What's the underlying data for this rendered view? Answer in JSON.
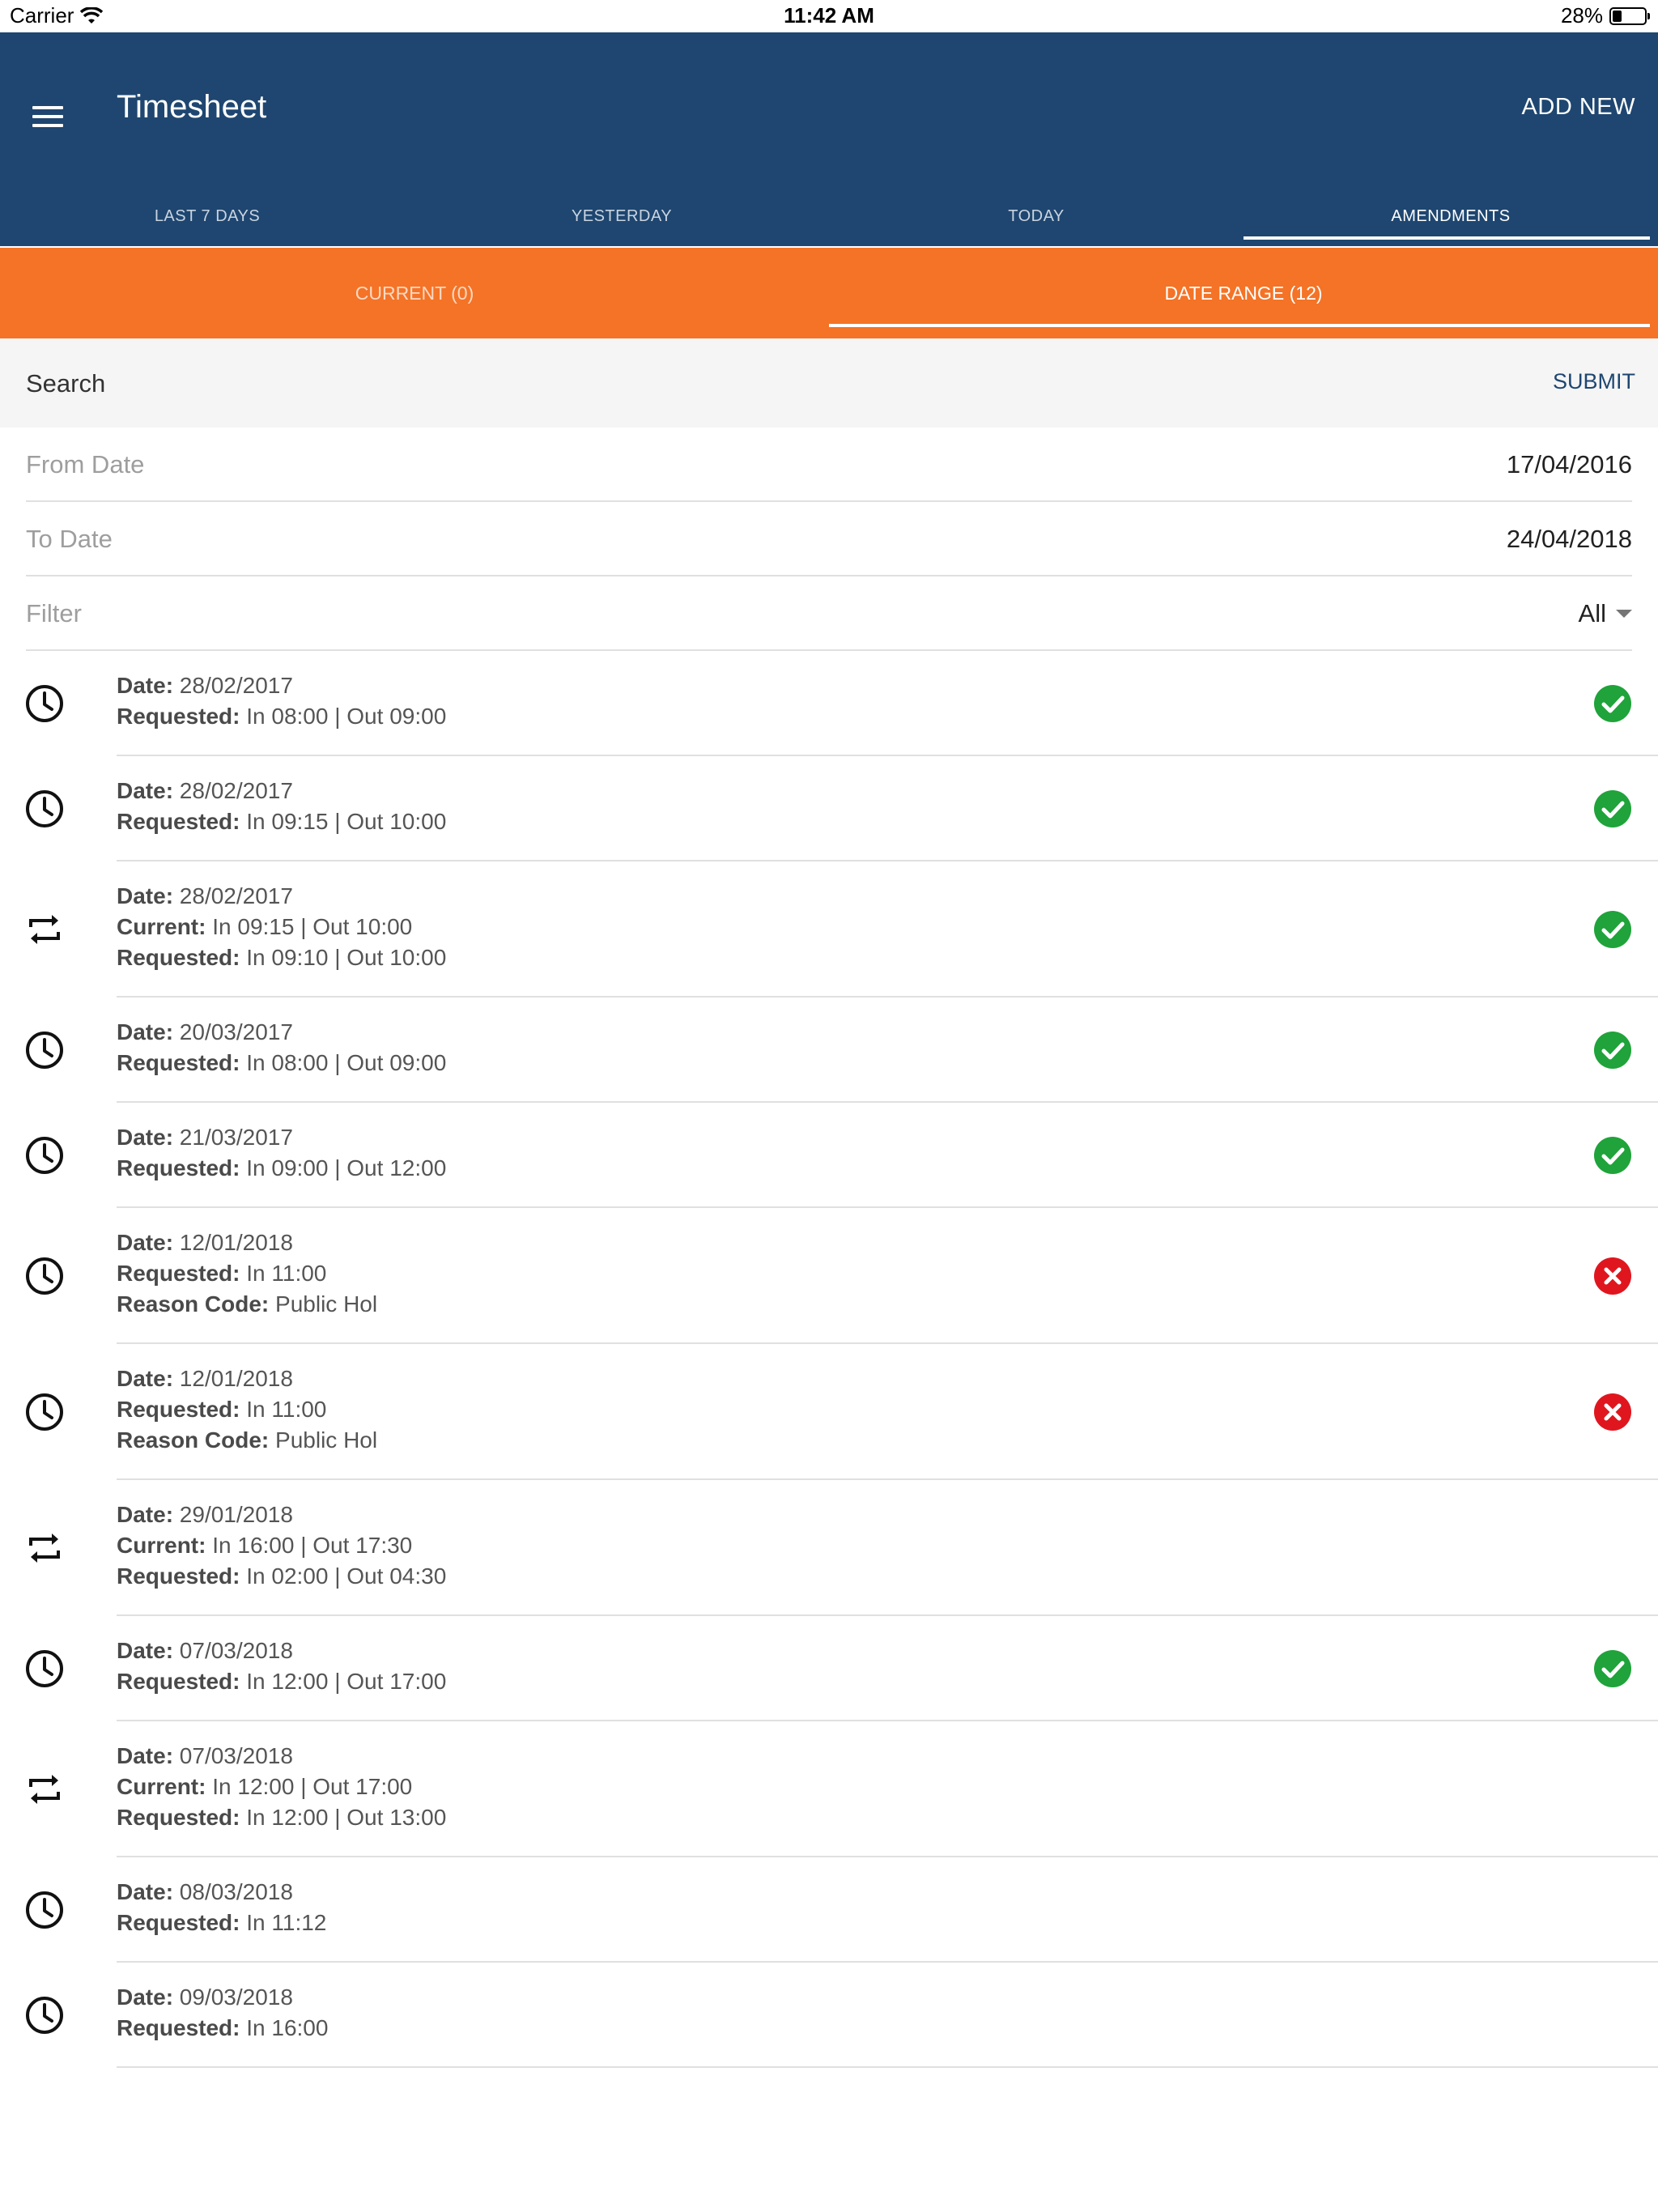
{
  "status_bar": {
    "carrier": "Carrier",
    "time": "11:42 AM",
    "battery": "28%",
    "battery_level": 0.28
  },
  "header": {
    "title": "Timesheet",
    "add_new": "ADD NEW"
  },
  "main_tabs": [
    {
      "label": "LAST 7 DAYS",
      "active": false
    },
    {
      "label": "YESTERDAY",
      "active": false
    },
    {
      "label": "TODAY",
      "active": false
    },
    {
      "label": "AMENDMENTS",
      "active": true
    }
  ],
  "sub_tabs": [
    {
      "label": "CURRENT (0)",
      "active": false
    },
    {
      "label": "DATE RANGE (12)",
      "active": true
    }
  ],
  "search": {
    "label": "Search",
    "submit": "SUBMIT"
  },
  "form": {
    "from_label": "From Date",
    "from_value": "17/04/2016",
    "to_label": "To Date",
    "to_value": "24/04/2018",
    "filter_label": "Filter",
    "filter_value": "All"
  },
  "colors": {
    "header": "#1e4670",
    "accent": "#f47326",
    "approved": "#1fa33a",
    "rejected": "#e0161f"
  },
  "items": [
    {
      "icon": "clock-icon",
      "status": "approved",
      "lines": [
        {
          "k": "Date:",
          "v": "28/02/2017"
        },
        {
          "k": "Requested:",
          "v": "In 08:00 | Out 09:00"
        }
      ]
    },
    {
      "icon": "clock-icon",
      "status": "approved",
      "lines": [
        {
          "k": "Date:",
          "v": "28/02/2017"
        },
        {
          "k": "Requested:",
          "v": "In 09:15 | Out 10:00"
        }
      ]
    },
    {
      "icon": "swap-icon",
      "status": "approved",
      "lines": [
        {
          "k": "Date:",
          "v": "28/02/2017"
        },
        {
          "k": "Current:",
          "v": "In 09:15 | Out 10:00"
        },
        {
          "k": "Requested:",
          "v": "In 09:10 | Out 10:00"
        }
      ]
    },
    {
      "icon": "clock-icon",
      "status": "approved",
      "lines": [
        {
          "k": "Date:",
          "v": "20/03/2017"
        },
        {
          "k": "Requested:",
          "v": "In 08:00 | Out 09:00"
        }
      ]
    },
    {
      "icon": "clock-icon",
      "status": "approved",
      "lines": [
        {
          "k": "Date:",
          "v": "21/03/2017"
        },
        {
          "k": "Requested:",
          "v": "In 09:00 | Out 12:00"
        }
      ]
    },
    {
      "icon": "clock-icon",
      "status": "rejected",
      "lines": [
        {
          "k": "Date:",
          "v": "12/01/2018"
        },
        {
          "k": "Requested:",
          "v": "In 11:00"
        },
        {
          "k": "Reason Code:",
          "v": "Public Hol"
        }
      ]
    },
    {
      "icon": "clock-icon",
      "status": "rejected",
      "lines": [
        {
          "k": "Date:",
          "v": "12/01/2018"
        },
        {
          "k": "Requested:",
          "v": "In 11:00"
        },
        {
          "k": "Reason Code:",
          "v": "Public Hol"
        }
      ]
    },
    {
      "icon": "swap-icon",
      "status": "none",
      "lines": [
        {
          "k": "Date:",
          "v": "29/01/2018"
        },
        {
          "k": "Current:",
          "v": "In 16:00 | Out 17:30"
        },
        {
          "k": "Requested:",
          "v": "In 02:00 | Out 04:30"
        }
      ]
    },
    {
      "icon": "clock-icon",
      "status": "approved",
      "lines": [
        {
          "k": "Date:",
          "v": "07/03/2018"
        },
        {
          "k": "Requested:",
          "v": "In 12:00 | Out 17:00"
        }
      ]
    },
    {
      "icon": "swap-icon",
      "status": "none",
      "lines": [
        {
          "k": "Date:",
          "v": "07/03/2018"
        },
        {
          "k": "Current:",
          "v": "In 12:00 | Out 17:00"
        },
        {
          "k": "Requested:",
          "v": "In 12:00 | Out 13:00"
        }
      ]
    },
    {
      "icon": "clock-icon",
      "status": "none",
      "lines": [
        {
          "k": "Date:",
          "v": "08/03/2018"
        },
        {
          "k": "Requested:",
          "v": "In 11:12"
        }
      ]
    },
    {
      "icon": "clock-icon",
      "status": "none",
      "lines": [
        {
          "k": "Date:",
          "v": "09/03/2018"
        },
        {
          "k": "Requested:",
          "v": "In 16:00"
        }
      ]
    }
  ]
}
